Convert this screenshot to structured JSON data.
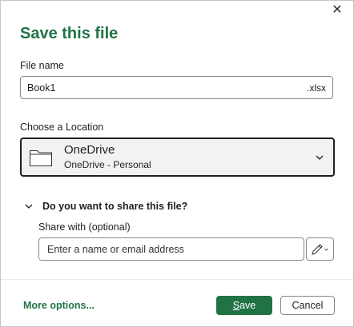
{
  "dialog": {
    "title": "Save this file",
    "close_glyph": "✕"
  },
  "file_name": {
    "label": "File name",
    "value": "Book1",
    "extension": ".xlsx"
  },
  "location": {
    "label": "Choose a Location",
    "name": "OneDrive",
    "detail": "OneDrive - Personal",
    "icon": "folder-icon"
  },
  "share": {
    "toggle_label": "Do you want to share this file?",
    "with_label": "Share with (optional)",
    "placeholder": "Enter a name or email address",
    "permission_icon": "pencil-icon"
  },
  "footer": {
    "more_options": "More options...",
    "save_first": "S",
    "save_rest": "ave",
    "cancel": "Cancel"
  },
  "colors": {
    "accent": "#217346",
    "border": "#8a8886",
    "selected_bg": "#f3f2f1"
  }
}
